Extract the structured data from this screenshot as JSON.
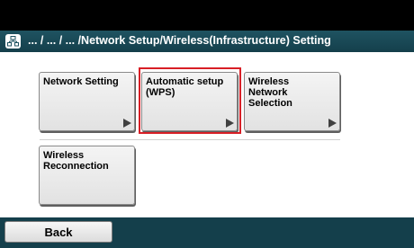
{
  "header": {
    "breadcrumb": "... / ... / ... /Network Setup/Wireless(Infrastructure) Setting",
    "icon": "network-icon"
  },
  "menu": {
    "items": [
      {
        "label": "Network Setting",
        "arrow": "right-arrow-icon"
      },
      {
        "label": "Automatic setup (WPS)",
        "arrow": "right-arrow-icon",
        "selected": true
      },
      {
        "label": "Wireless Network Selection",
        "arrow": "right-arrow-icon"
      },
      {
        "label": "Wireless Reconnection"
      }
    ]
  },
  "footer": {
    "back_label": "Back"
  },
  "colors": {
    "header_bg": "#1f5361",
    "footer_bg": "#143f4b",
    "selection_outline": "#d81f26",
    "tile_bg": "#eaeaea"
  }
}
